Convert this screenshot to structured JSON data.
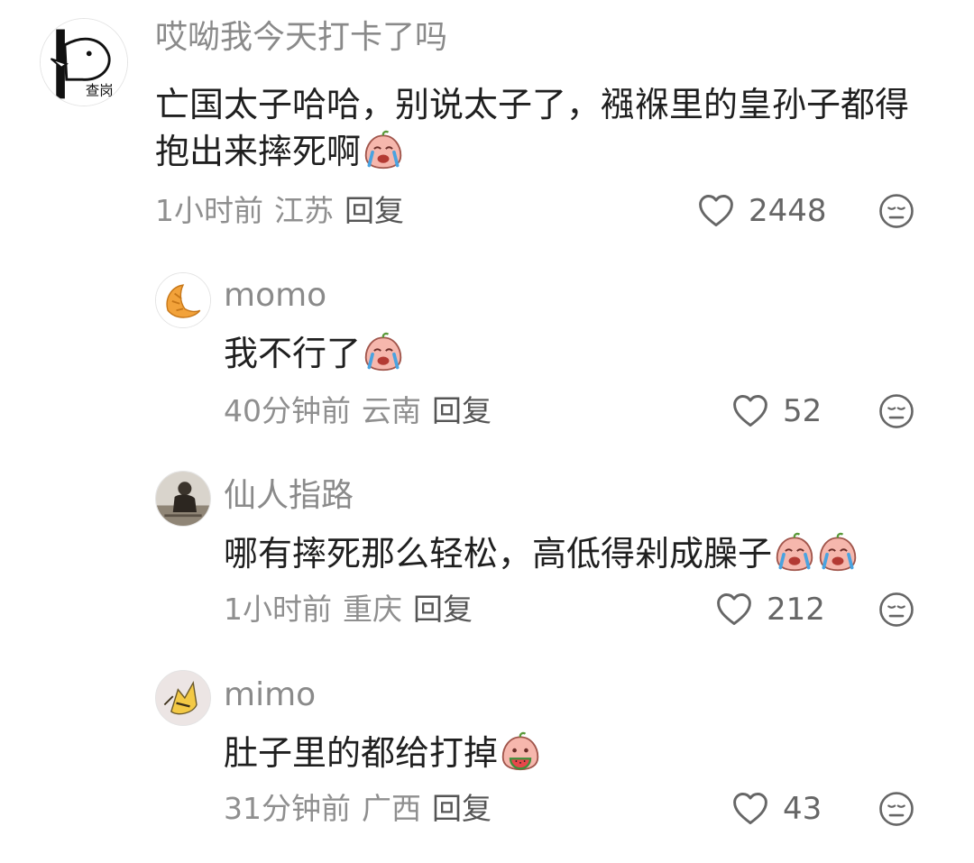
{
  "comments": [
    {
      "username": "哎呦我今天打卡了吗",
      "text": "亡国太子哈哈，别说太子了，襁褓里的皇孙子都得抱出来摔死啊",
      "time": "1小时前",
      "location": "江苏",
      "reply_label": "回复",
      "likes": "2448",
      "avatar_icon": "meme-avatar-icon",
      "avatar_text": "查岗",
      "emoji_icons": [
        "crying-peach-emoji-icon"
      ]
    },
    {
      "username": "momo",
      "text": "我不行了",
      "time": "40分钟前",
      "location": "云南",
      "reply_label": "回复",
      "likes": "52",
      "avatar_icon": "croissant-avatar-icon",
      "emoji_icons": [
        "crying-peach-emoji-icon"
      ]
    },
    {
      "username": "仙人指路",
      "text": "哪有摔死那么轻松，高低得剁成臊子",
      "time": "1小时前",
      "location": "重庆",
      "reply_label": "回复",
      "likes": "212",
      "avatar_icon": "sepia-photo-avatar-icon",
      "emoji_icons": [
        "crying-peach-emoji-icon",
        "crying-peach-emoji-icon"
      ]
    },
    {
      "username": "mimo",
      "text": "肚子里的都给打掉",
      "time": "31分钟前",
      "location": "广西",
      "reply_label": "回复",
      "likes": "43",
      "avatar_icon": "yellow-cartoon-avatar-icon",
      "emoji_icons": [
        "eating-watermelon-peach-emoji-icon"
      ]
    }
  ],
  "colors": {
    "username": "#8a8a8a",
    "text": "#1f1f1f",
    "meta": "#8f8f8f",
    "icon": "#666666"
  }
}
